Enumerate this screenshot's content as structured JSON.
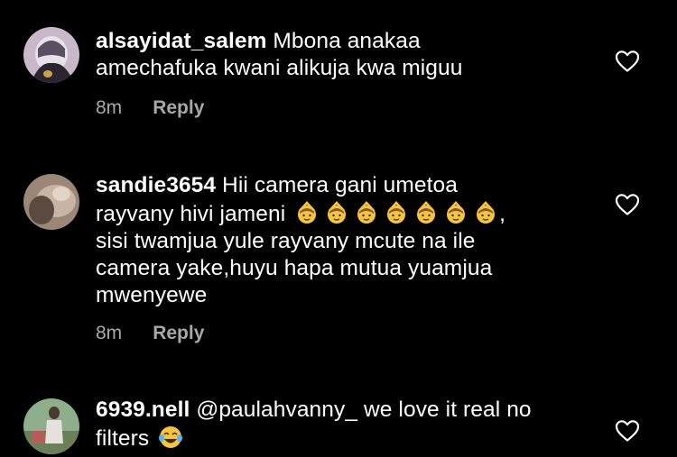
{
  "comments": [
    {
      "username": "alsayidat_salem",
      "line1": "Mbona anakaa",
      "line2": "amechafuka kwani alikuja kwa miguu",
      "time": "8m",
      "reply": "Reply"
    },
    {
      "username": "sandie3654",
      "line1": "Hii camera gani umetoa",
      "line2_pre": "rayvany hivi jameni",
      "line2_post": ",",
      "line3": "sisi twamjua yule rayvany mcute na ile",
      "line4": "camera yake,huyu hapa mutua yuamjua",
      "line5": "mwenyewe",
      "emoji": "person-gesturing-ok-emoji",
      "emoji_count": 7,
      "time": "8m",
      "reply": "Reply"
    },
    {
      "username": "6939.nell",
      "line1": "@paulahvanny_ we love it real no",
      "line2": "filters",
      "emoji": "tears-of-joy-emoji"
    }
  ],
  "colors": {
    "background": "#000000",
    "text": "#ffffff",
    "meta": "#a8a8a8",
    "emoji": "#f5c443"
  }
}
